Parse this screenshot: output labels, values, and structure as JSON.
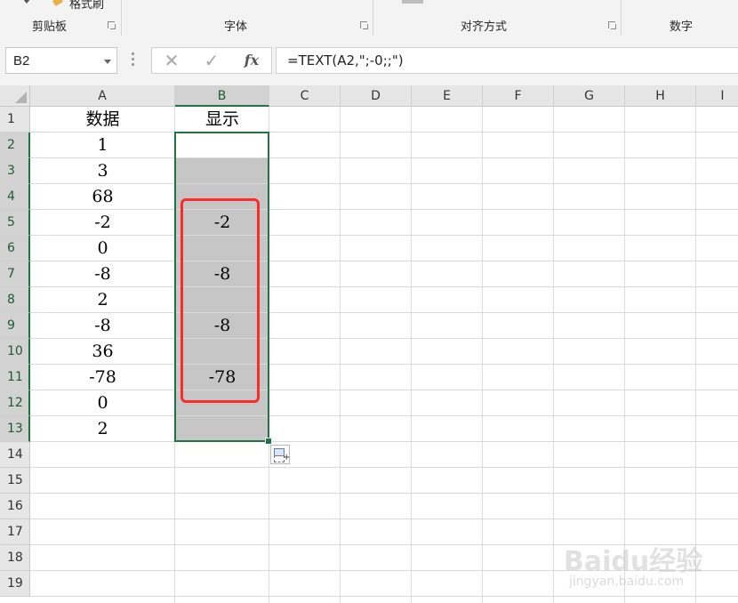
{
  "ribbon": {
    "format_painter_label": "格式刷",
    "groups": [
      {
        "label": "剪贴板"
      },
      {
        "label": "字体"
      },
      {
        "label": "对齐方式"
      },
      {
        "label": "数字"
      }
    ]
  },
  "formula_bar": {
    "name_box": "B2",
    "cancel_icon": "✕",
    "enter_icon": "✓",
    "fx_label": "fx",
    "formula": "=TEXT(A2,\";-0;;\")"
  },
  "columns": [
    "A",
    "B",
    "C",
    "D",
    "E",
    "F",
    "G",
    "H",
    "I"
  ],
  "rows": [
    "1",
    "2",
    "3",
    "4",
    "5",
    "6",
    "7",
    "8",
    "9",
    "10",
    "11",
    "12",
    "13",
    "14",
    "15",
    "16",
    "17",
    "18",
    "19"
  ],
  "cells": {
    "A": [
      "数据",
      "1",
      "3",
      "68",
      "-2",
      "0",
      "-8",
      "2",
      "-8",
      "36",
      "-78",
      "0",
      "2"
    ],
    "B": [
      "显示",
      "",
      "",
      "",
      "-2",
      "",
      "-8",
      "",
      "-8",
      "",
      "-78",
      "",
      ""
    ]
  },
  "selection": {
    "active_cell": "B2",
    "range": "B2:B13"
  },
  "colors": {
    "selection_border": "#217346",
    "highlight_box": "#ff2a2a",
    "selection_fill": "#c6c6c6"
  },
  "watermark": {
    "main": "Baidu经验",
    "sub": "jingyan.baidu.com"
  }
}
